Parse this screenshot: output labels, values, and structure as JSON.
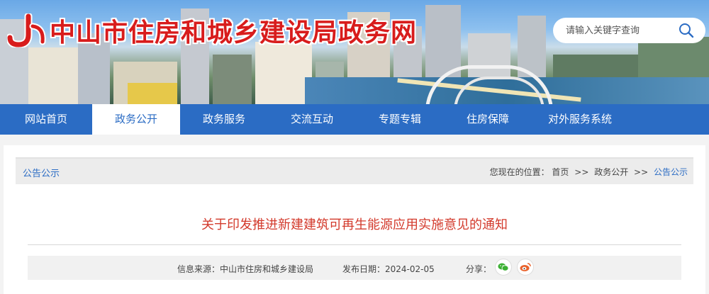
{
  "header": {
    "site_title": "中山市住房和城乡建设局政务网",
    "search_placeholder": "请输入关键字查询"
  },
  "nav": {
    "items": [
      "网站首页",
      "政务公开",
      "政务服务",
      "交流互动",
      "专题专辑",
      "住房保障",
      "对外服务系统"
    ],
    "active_index": 1
  },
  "breadcrumb": {
    "section": "公告公示",
    "prefix": "您现在的位置：",
    "path": [
      "首页",
      "政务公开",
      "公告公示"
    ],
    "separator": ">>"
  },
  "article": {
    "title": "关于印发推进新建建筑可再生能源应用实施意见的通知",
    "source_label": "信息来源：",
    "source": "中山市住房和城乡建设局",
    "date_label": "发布日期：",
    "date": "2024-02-05",
    "share_label": "分享："
  },
  "colors": {
    "nav_blue": "#2b6cc4",
    "title_red": "#d81c1c",
    "article_title_red": "#d33a2c",
    "wechat_green": "#3cb034",
    "weibo_orange": "#e8622c"
  },
  "icons": [
    "logo-icon",
    "search-icon",
    "wechat-icon",
    "weibo-icon"
  ]
}
